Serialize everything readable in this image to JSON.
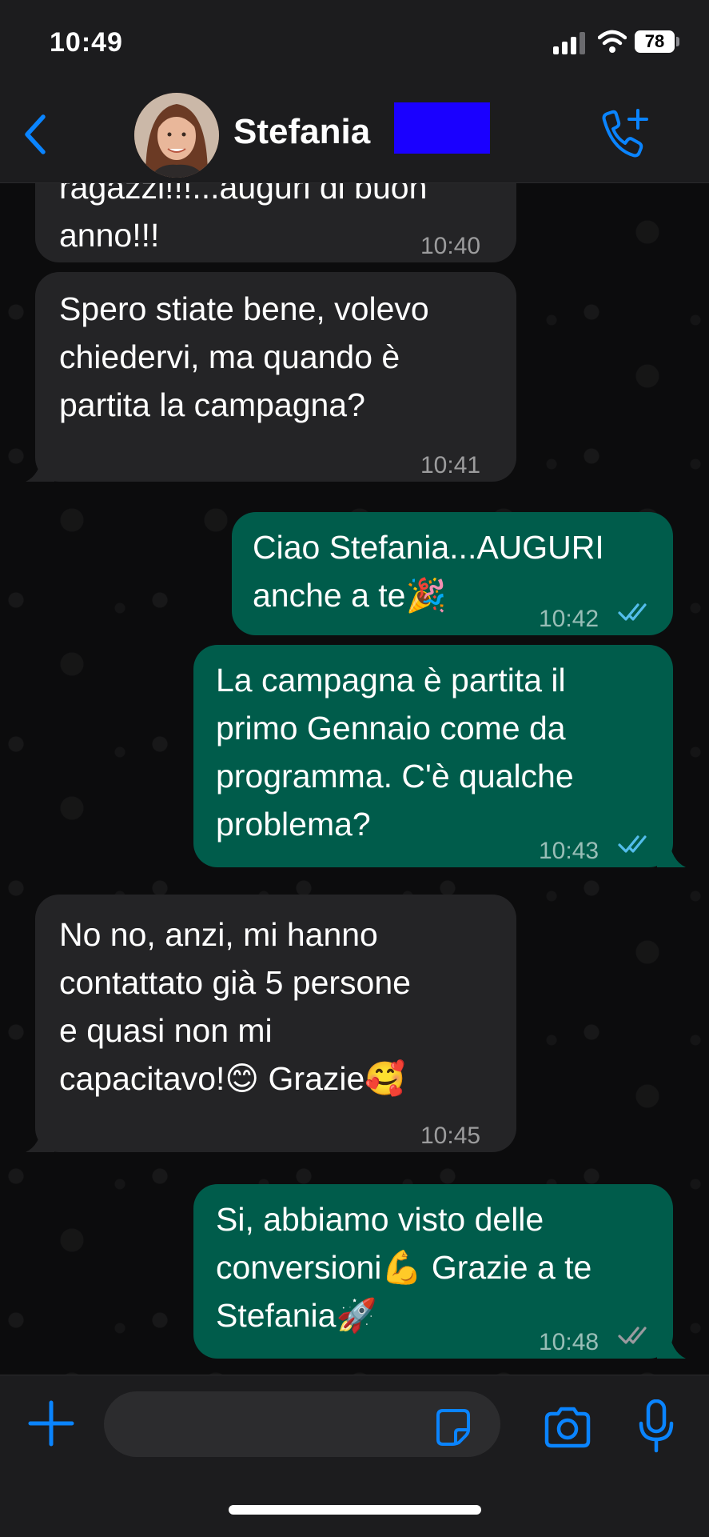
{
  "status_bar": {
    "time": "10:49",
    "battery": "78"
  },
  "header": {
    "contact_name": "Stefania",
    "icons": {
      "back": "chevron-left-icon",
      "call": "add-call-icon"
    }
  },
  "messages": [
    {
      "direction": "in",
      "lines": [
        "ragazzi!!!...auguri di buon",
        "anno!!!"
      ],
      "time": "10:40"
    },
    {
      "direction": "in",
      "lines": [
        "Spero stiate bene, volevo",
        "chiedervi, ma quando è",
        "partita la campagna?"
      ],
      "time": "10:41"
    },
    {
      "direction": "out",
      "lines": [
        "Ciao Stefania...AUGURI",
        "anche a te🎉"
      ],
      "time": "10:42",
      "status": "read"
    },
    {
      "direction": "out",
      "lines": [
        "La campagna è partita il",
        "primo Gennaio come da",
        "programma. C'è qualche",
        "problema?"
      ],
      "time": "10:43",
      "status": "read"
    },
    {
      "direction": "in",
      "lines": [
        "No no, anzi, mi hanno",
        "contattato già 5 persone",
        "e quasi non mi",
        "capacitavo!😊 Grazie🥰"
      ],
      "time": "10:45"
    },
    {
      "direction": "out",
      "lines": [
        "Si, abbiamo visto delle",
        "conversioni💪 Grazie a te",
        "Stefania🚀"
      ],
      "time": "10:48",
      "status": "delivered"
    }
  ],
  "composer": {
    "placeholder": "",
    "icons": {
      "plus": "plus-icon",
      "sticker": "sticker-icon",
      "camera": "camera-icon",
      "mic": "microphone-icon"
    }
  },
  "colors": {
    "accent": "#0a84ff",
    "incoming_bubble": "#242426",
    "outgoing_bubble": "#005c4b",
    "read_tick": "#53bdeb"
  }
}
